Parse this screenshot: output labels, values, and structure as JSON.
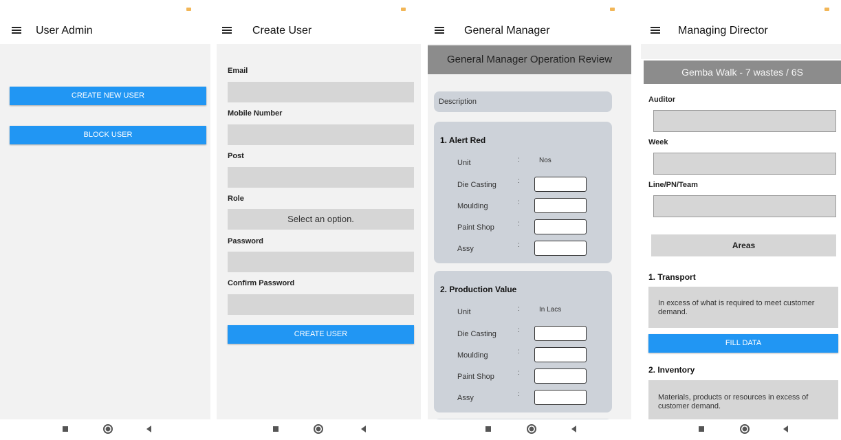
{
  "screens": {
    "user_admin": {
      "title": "User Admin",
      "create_new_user": "CREATE NEW USER",
      "block_user": "BLOCK USER"
    },
    "create_user": {
      "title": "Create User",
      "email_label": "Email",
      "mobile_label": "Mobile Number",
      "post_label": "Post",
      "role_label": "Role",
      "role_select": "Select an option.",
      "password_label": "Password",
      "confirm_password_label": "Confirm Password",
      "create_user_button": "CREATE USER"
    },
    "general_manager": {
      "title": "General Manager",
      "header": "General Manager Operation Review",
      "description": "Description",
      "sections": [
        {
          "title": "1.  Alert Red",
          "unit_label": "Unit",
          "unit_value": "Nos",
          "rows": [
            "Die Casting",
            "Moulding",
            "Paint Shop",
            "Assy"
          ]
        },
        {
          "title": "2.  Production Value",
          "unit_label": "Unit",
          "unit_value": "In Lacs",
          "rows": [
            "Die Casting",
            "Moulding",
            "Paint Shop",
            "Assy"
          ]
        }
      ]
    },
    "managing_director": {
      "title": "Managing Director",
      "header": "Gemba Walk - 7 wastes / 6S",
      "auditor_label": "Auditor",
      "week_label": "Week",
      "line_label": "Line/PN/Team",
      "areas_button": "Areas",
      "transport_title": "1. Transport",
      "transport_desc": "In excess of what is required to meet customer demand.",
      "fill_data_button": "FILL DATA",
      "inventory_title": "2. Inventory",
      "inventory_desc": "Materials, products or resources in excess of customer demand."
    }
  },
  "colors": {
    "accent": "#2196f3",
    "field": "#d6d6d6",
    "card": "#cdd2d9",
    "header": "#8c8c8c"
  }
}
